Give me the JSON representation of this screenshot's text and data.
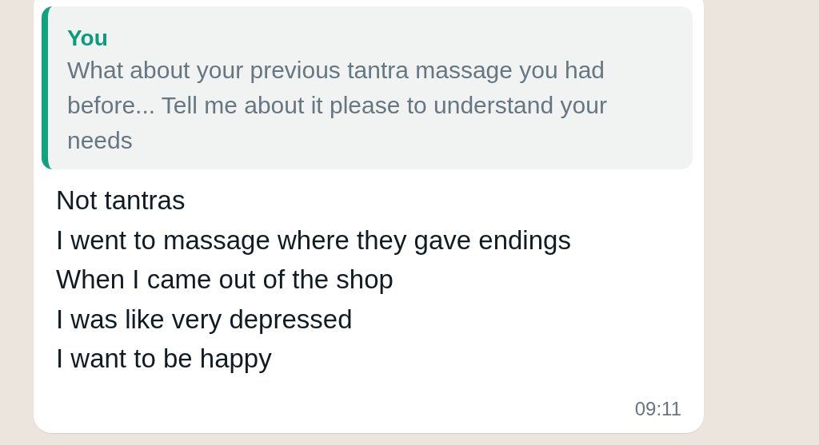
{
  "message": {
    "quote": {
      "author": "You",
      "text": "What about your previous tantra massage you had before... Tell me about it please to understand your needs"
    },
    "text": "Not tantras\nI went to massage where they gave endings\nWhen I came out of the shop\nI was like very depressed\nI want to be happy",
    "time": "09:11"
  }
}
